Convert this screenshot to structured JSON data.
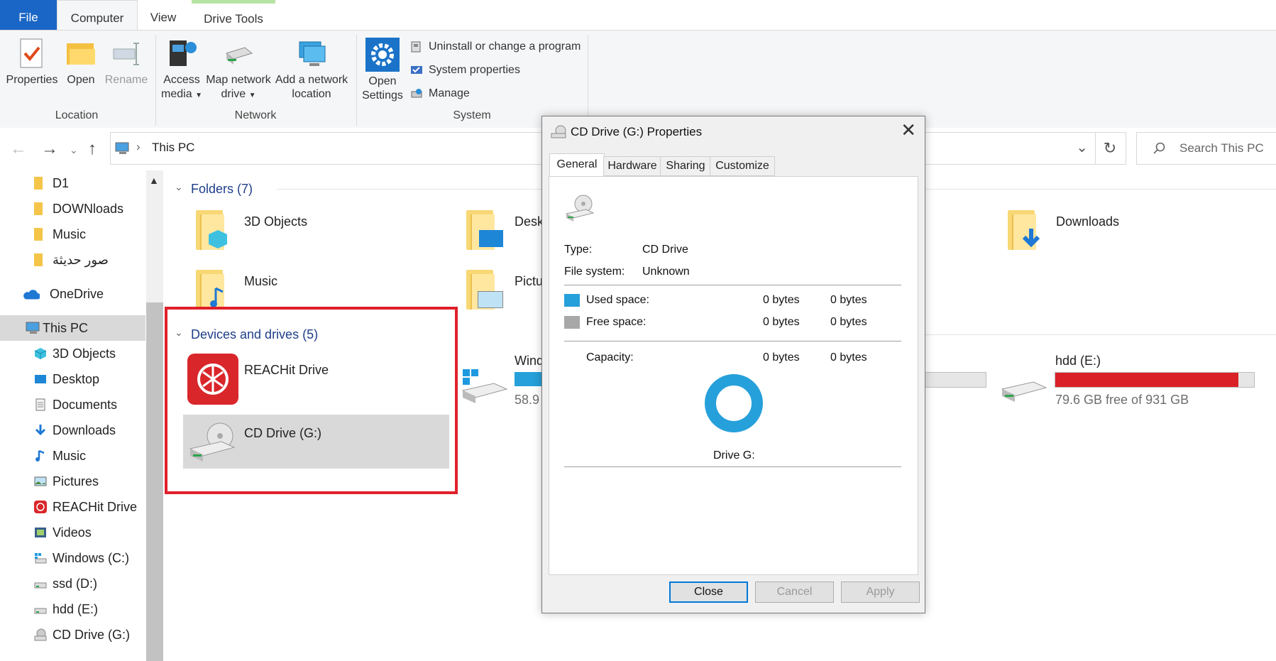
{
  "ribbon_tabs": {
    "file": "File",
    "computer": "Computer",
    "view": "View",
    "drive_tools": "Drive Tools"
  },
  "ribbon": {
    "location": {
      "label": "Location",
      "properties": "Properties",
      "open": "Open",
      "rename": "Rename"
    },
    "network": {
      "label": "Network",
      "access_media_1": "Access",
      "access_media_2": "media",
      "map_drive_1": "Map network",
      "map_drive_2": "drive",
      "add_location_1": "Add a network",
      "add_location_2": "location"
    },
    "system": {
      "label": "System",
      "open_settings_1": "Open",
      "open_settings_2": "Settings",
      "uninstall": "Uninstall or change a program",
      "system_properties": "System properties",
      "manage": "Manage"
    }
  },
  "address": {
    "path": "This PC",
    "search_placeholder": "Search This PC"
  },
  "nav_pane": [
    {
      "label": "D1",
      "icon": "folder-icon"
    },
    {
      "label": "DOWNloads",
      "icon": "folder-icon"
    },
    {
      "label": "Music",
      "icon": "folder-icon"
    },
    {
      "label": "صور حديثة",
      "icon": "folder-icon"
    },
    {
      "label": "OneDrive",
      "icon": "onedrive-icon"
    },
    {
      "label": "This PC",
      "icon": "computer-icon"
    },
    {
      "label": "3D Objects",
      "icon": "3d-objects-icon"
    },
    {
      "label": "Desktop",
      "icon": "desktop-icon"
    },
    {
      "label": "Documents",
      "icon": "documents-icon"
    },
    {
      "label": "Downloads",
      "icon": "downloads-icon"
    },
    {
      "label": "Music",
      "icon": "music-icon"
    },
    {
      "label": "Pictures",
      "icon": "pictures-icon"
    },
    {
      "label": "REACHit Drive",
      "icon": "reachit-icon"
    },
    {
      "label": "Videos",
      "icon": "videos-icon"
    },
    {
      "label": "Windows (C:)",
      "icon": "windows-drive-icon"
    },
    {
      "label": "ssd  (D:)",
      "icon": "drive-icon"
    },
    {
      "label": "hdd  (E:)",
      "icon": "drive-icon"
    },
    {
      "label": "CD Drive (G:)",
      "icon": "cd-drive-icon"
    }
  ],
  "content": {
    "folders_header": "Folders (7)",
    "folders": [
      "3D Objects",
      "Deskt",
      "Downloads",
      "Music",
      "Pictu"
    ],
    "devices_header": "Devices and drives (5)",
    "devices": {
      "reachit": "REACHit Drive",
      "cd": "CD Drive (G:)",
      "windows": "Wind",
      "windows_free": "58.9",
      "hdd": "hdd  (E:)",
      "hdd_free": "79.6 GB free of 931 GB",
      "hdd_used_fraction": 0.92
    }
  },
  "dialog": {
    "title": "CD Drive (G:) Properties",
    "tabs": [
      "General",
      "Hardware",
      "Sharing",
      "Customize"
    ],
    "type_label": "Type:",
    "type_value": "CD Drive",
    "fs_label": "File system:",
    "fs_value": "Unknown",
    "used_label": "Used space:",
    "used_bytes": "0 bytes",
    "used_size": "0 bytes",
    "free_label": "Free space:",
    "free_bytes": "0 bytes",
    "free_size": "0 bytes",
    "capacity_label": "Capacity:",
    "capacity_bytes": "0 bytes",
    "capacity_size": "0 bytes",
    "drive_label": "Drive G:",
    "buttons": {
      "close": "Close",
      "cancel": "Cancel",
      "apply": "Apply"
    },
    "colors": {
      "used": "#26a0da",
      "free": "#a8a8a8"
    }
  },
  "highlight_color": "#e0202a"
}
